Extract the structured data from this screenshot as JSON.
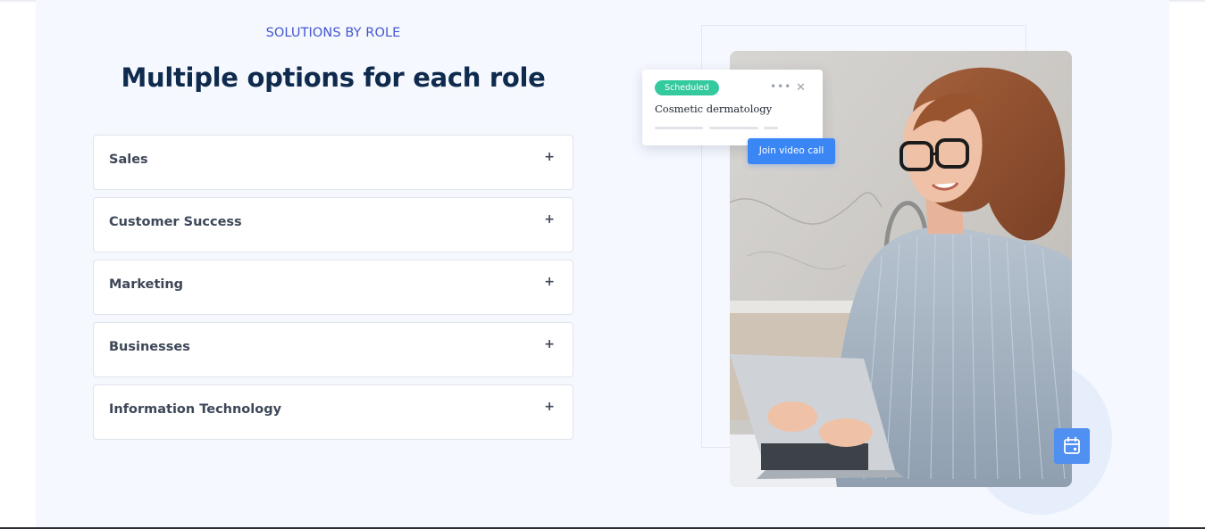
{
  "section": {
    "eyebrow": "SOLUTIONS BY ROLE",
    "heading": "Multiple options for each role"
  },
  "accordion": {
    "items": [
      {
        "label": "Sales",
        "icon": "+"
      },
      {
        "label": "Customer Success",
        "icon": "+"
      },
      {
        "label": "Marketing",
        "icon": "+"
      },
      {
        "label": "Businesses",
        "icon": "+"
      },
      {
        "label": "Information Technology",
        "icon": "+"
      }
    ]
  },
  "card": {
    "badge": "Scheduled",
    "menu": "•••",
    "close": "✕",
    "title": "Cosmetic dermatology",
    "button": "Join video call"
  },
  "icons": {
    "expand": "plus-icon",
    "menu": "more-dots-icon",
    "close": "close-icon",
    "calendar": "calendar-icon"
  },
  "colors": {
    "accent": "#4456cf",
    "heading": "#0e2a4d",
    "badge": "#34c99f",
    "button": "#3b86f5",
    "calendar_button": "#4f90f0",
    "background": "#f5f8fe"
  }
}
